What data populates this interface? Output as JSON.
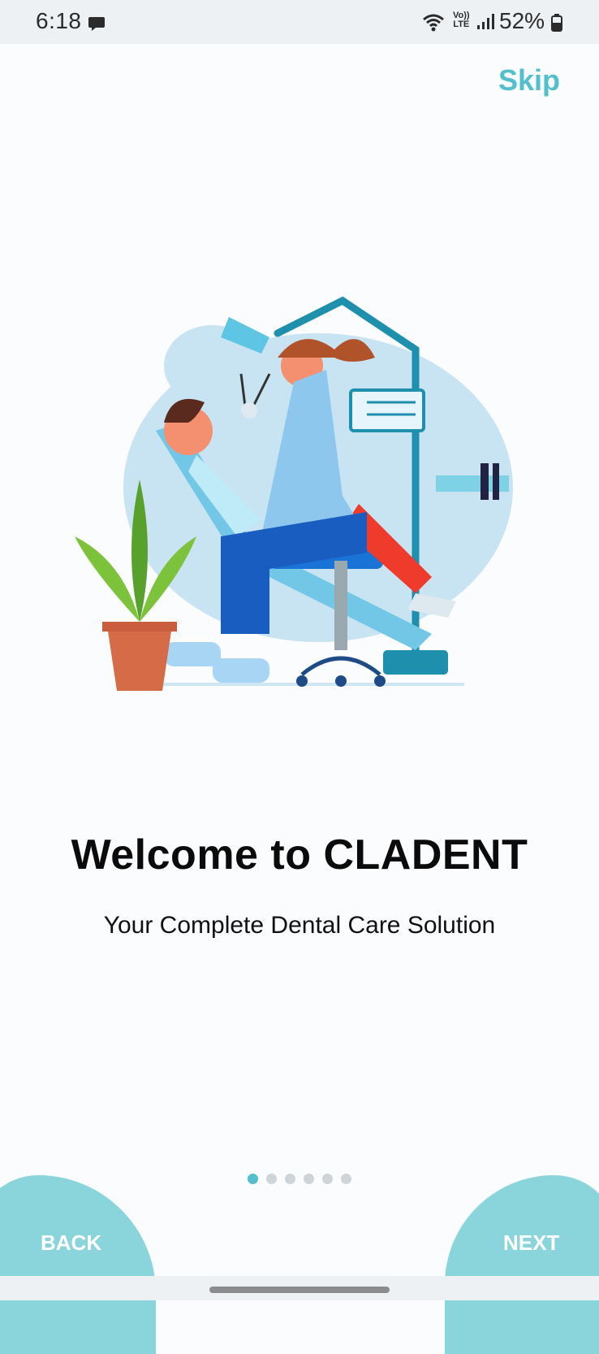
{
  "status_bar": {
    "time": "6:18",
    "battery": "52%",
    "lte_top": "Vo))",
    "lte_bottom": "LTE"
  },
  "header": {
    "skip_label": "Skip"
  },
  "hero": {
    "title": "Welcome to CLADENT",
    "subtitle": "Your Complete Dental Care Solution"
  },
  "pagination": {
    "count": 6,
    "active_index": 0
  },
  "footer": {
    "back_label": "BACK",
    "next_label": "NEXT"
  },
  "colors": {
    "accent": "#53bfcc",
    "button_blob": "#8ad5dc",
    "title": "#0b0b0b"
  },
  "icons": [
    "message-icon",
    "wifi-icon",
    "lte-icon",
    "signal-icon",
    "battery-icon",
    "dentist-illustration"
  ]
}
